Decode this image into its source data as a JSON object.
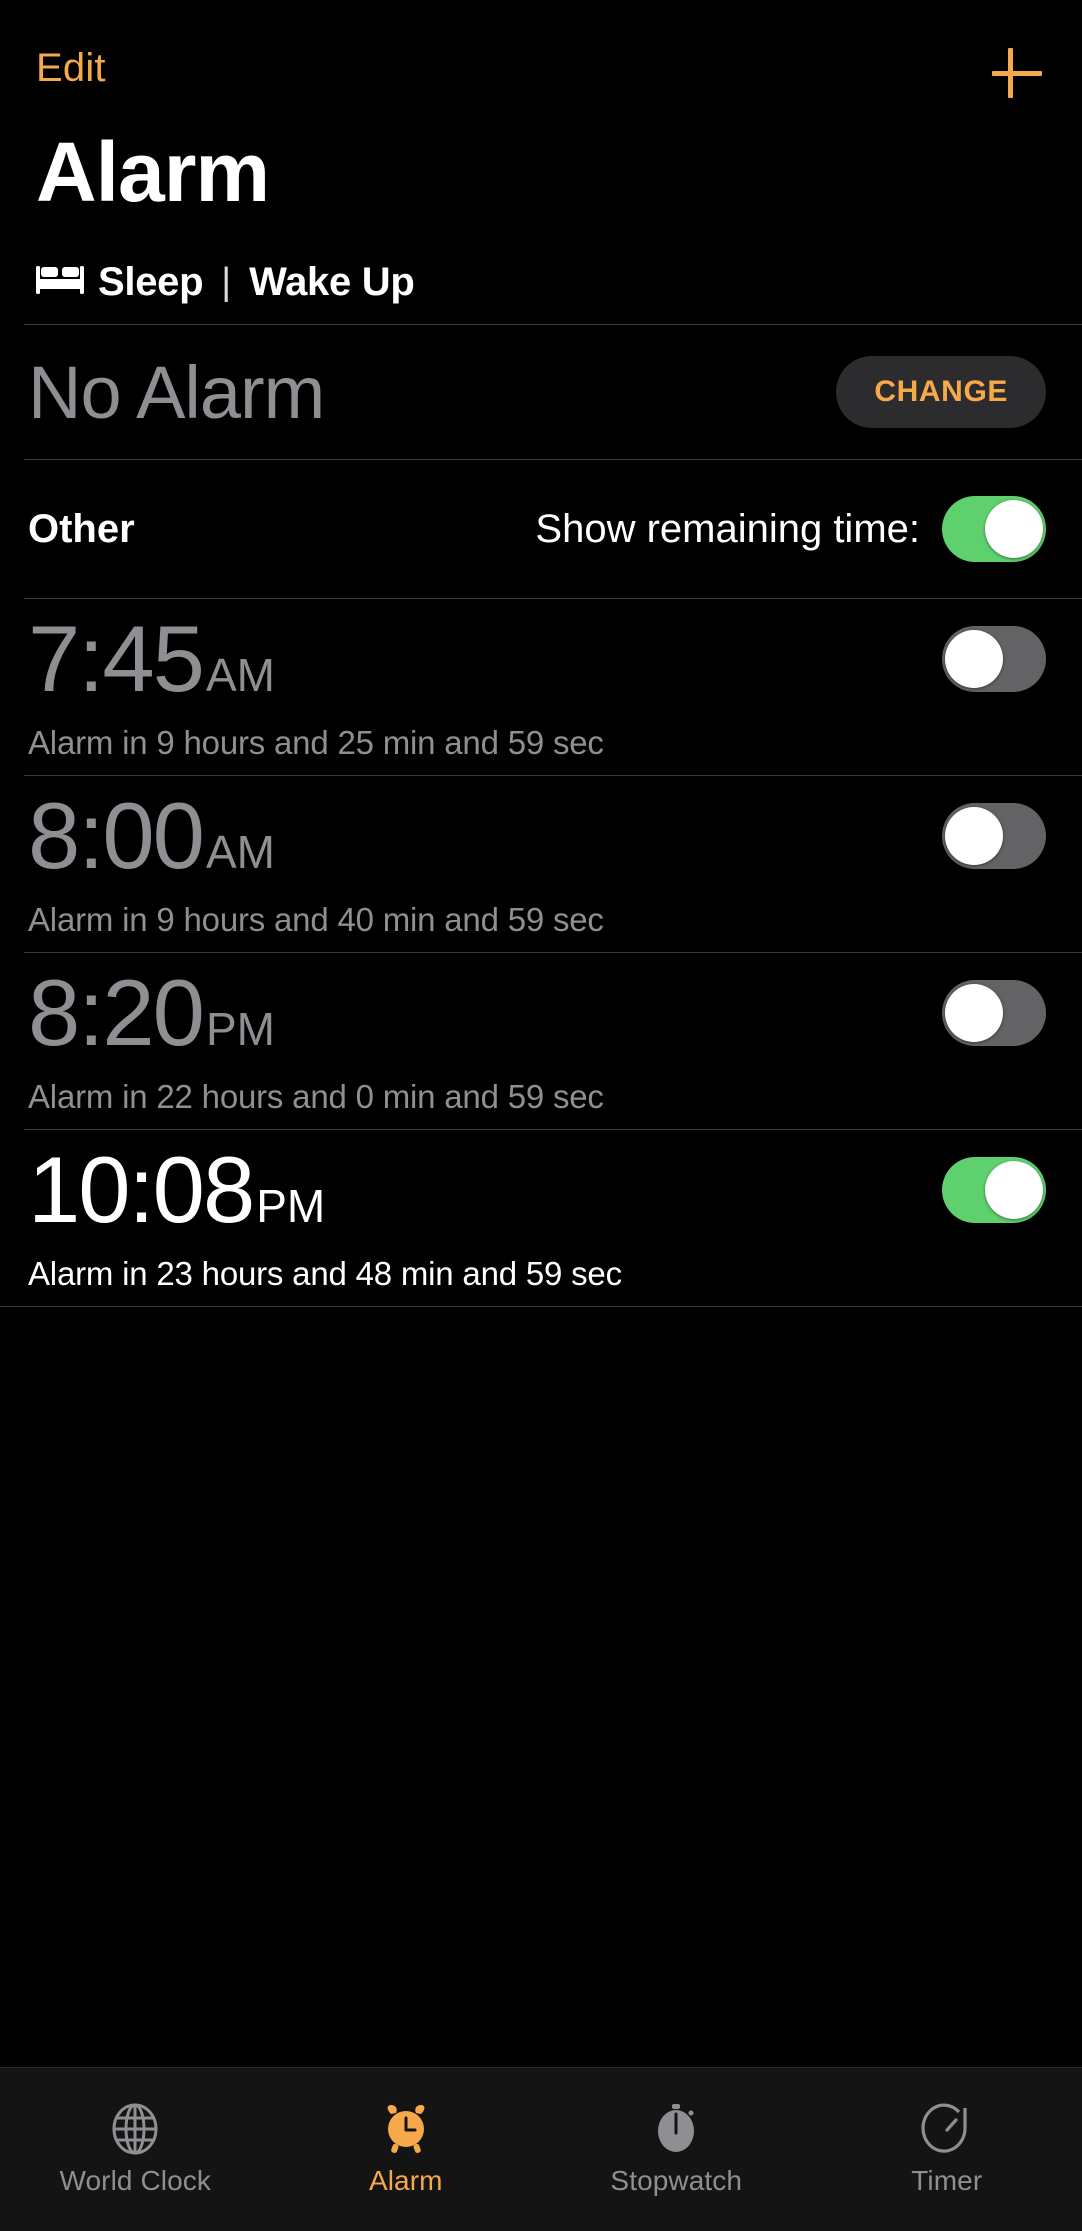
{
  "navbar": {
    "edit_label": "Edit",
    "add_icon": "plus-icon",
    "accent_color": "#f5a94b"
  },
  "header": {
    "title": "Alarm"
  },
  "sleep_section": {
    "bed_icon": "bed-icon",
    "sleep_label": "Sleep",
    "separator": "|",
    "wake_label": "Wake Up",
    "alarm_value": "No Alarm",
    "change_label": "CHANGE"
  },
  "other_section": {
    "title": "Other",
    "show_remaining_label": "Show remaining time:",
    "show_remaining_enabled": true
  },
  "alarms": [
    {
      "time": "7:45",
      "meridiem": "AM",
      "subtitle": "Alarm in 9 hours and 25 min and 59 sec",
      "enabled": false
    },
    {
      "time": "8:00",
      "meridiem": "AM",
      "subtitle": "Alarm in 9 hours and 40 min and 59 sec",
      "enabled": false
    },
    {
      "time": "8:20",
      "meridiem": "PM",
      "subtitle": "Alarm in 22 hours and 0 min and 59 sec",
      "enabled": false
    },
    {
      "time": "10:08",
      "meridiem": "PM",
      "subtitle": "Alarm in 23 hours and 48 min and 59 sec",
      "enabled": true
    }
  ],
  "tabbar": {
    "tabs": [
      {
        "label": "World Clock",
        "icon": "globe-icon",
        "active": false
      },
      {
        "label": "Alarm",
        "icon": "alarm-clock-icon",
        "active": true
      },
      {
        "label": "Stopwatch",
        "icon": "stopwatch-icon",
        "active": false
      },
      {
        "label": "Timer",
        "icon": "timer-icon",
        "active": false
      }
    ]
  },
  "colors": {
    "accent": "#f5a94b",
    "toggle_on": "#5ed16e",
    "toggle_off": "#636366",
    "dim_text": "#8e8e93",
    "background": "#000000",
    "divider": "#3a3a3c",
    "button_bg": "#2c2c2e"
  }
}
